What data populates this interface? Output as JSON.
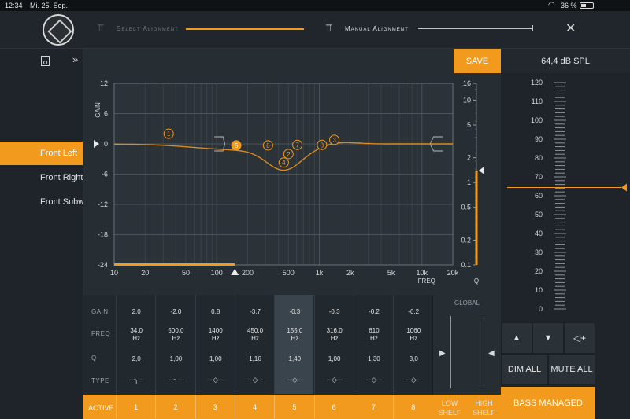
{
  "statusbar": {
    "time": "12:34",
    "date": "Mi. 25. Sep.",
    "battery": "36 %",
    "wifi_icon": "wifi-icon",
    "battery_icon": "battery-icon"
  },
  "topbar": {
    "select_alignment": "Select Alignment",
    "manual_alignment": "Manual Alignment",
    "close_icon": "close-icon"
  },
  "left": {
    "channels": [
      "Front Left",
      "Front Right",
      "Front Subwoofer"
    ],
    "selected": 0
  },
  "save_label": "SAVE",
  "plot": {
    "gain_label": "GAIN",
    "gain_ticks": [
      "12",
      "6",
      "0",
      "-6",
      "-12",
      "-18",
      "-24"
    ],
    "freq_ticks": [
      "10",
      "20",
      "50",
      "100",
      "200",
      "500",
      "1k",
      "2k",
      "5k",
      "10k",
      "20k"
    ],
    "freq_label": "FREQ",
    "q_ticks": [
      "16",
      "10",
      "5",
      "2",
      "1",
      "0.5",
      "0.2",
      "0.1"
    ],
    "q_label": "Q",
    "markers": [
      {
        "num": "1",
        "freq": 34,
        "gain": 2.0
      },
      {
        "num": "2",
        "freq": 500,
        "gain": -2.0
      },
      {
        "num": "3",
        "freq": 1400,
        "gain": 0.8
      },
      {
        "num": "4",
        "freq": 450,
        "gain": -3.7
      },
      {
        "num": "5",
        "freq": 155,
        "gain": -0.3
      },
      {
        "num": "6",
        "freq": 316,
        "gain": -0.3
      },
      {
        "num": "7",
        "freq": 610,
        "gain": -0.2
      },
      {
        "num": "8",
        "freq": 1060,
        "gain": -0.2
      }
    ],
    "selected_marker": "5"
  },
  "table": {
    "row_labels": [
      "GAIN",
      "FREQ",
      "Q",
      "TYPE"
    ],
    "active_label": "ACTIVE",
    "columns": [
      {
        "gain": "2,0",
        "freq": "34,0",
        "unit": "Hz",
        "q": "2,0",
        "type": "low-shelf-icon",
        "num": "1"
      },
      {
        "gain": "-2,0",
        "freq": "500,0",
        "unit": "Hz",
        "q": "1,00",
        "type": "low-shelf-icon",
        "num": "2"
      },
      {
        "gain": "0,8",
        "freq": "1400",
        "unit": "Hz",
        "q": "1,00",
        "type": "peak-icon",
        "num": "3"
      },
      {
        "gain": "-3,7",
        "freq": "450,0",
        "unit": "Hz",
        "q": "1,16",
        "type": "peak-icon",
        "num": "4"
      },
      {
        "gain": "-0,3",
        "freq": "155,0",
        "unit": "Hz",
        "q": "1,40",
        "type": "peak-icon",
        "num": "5"
      },
      {
        "gain": "-0,3",
        "freq": "316,0",
        "unit": "Hz",
        "q": "1,00",
        "type": "peak-icon",
        "num": "6"
      },
      {
        "gain": "-0,2",
        "freq": "610",
        "unit": "Hz",
        "q": "1,30",
        "type": "peak-icon",
        "num": "7"
      },
      {
        "gain": "-0,2",
        "freq": "1060",
        "unit": "Hz",
        "q": "3,0",
        "type": "peak-icon",
        "num": "8"
      }
    ],
    "selected_column": 4,
    "global_label": "GLOBAL",
    "low_shelf": "LOW SHELF",
    "high_shelf": "HIGH SHELF"
  },
  "right": {
    "spl": "64,4 dB SPL",
    "scale": [
      "120",
      "110",
      "100",
      "90",
      "80",
      "70",
      "60",
      "50",
      "40",
      "30",
      "20",
      "10",
      "0"
    ],
    "level": 64.4,
    "dim_all": "DIM ALL",
    "mute_all": "MUTE ALL",
    "bass_managed": "BASS MANAGED"
  },
  "colors": {
    "accent": "#f29a1e",
    "background": "#1b2025",
    "panel": "#262d33"
  }
}
